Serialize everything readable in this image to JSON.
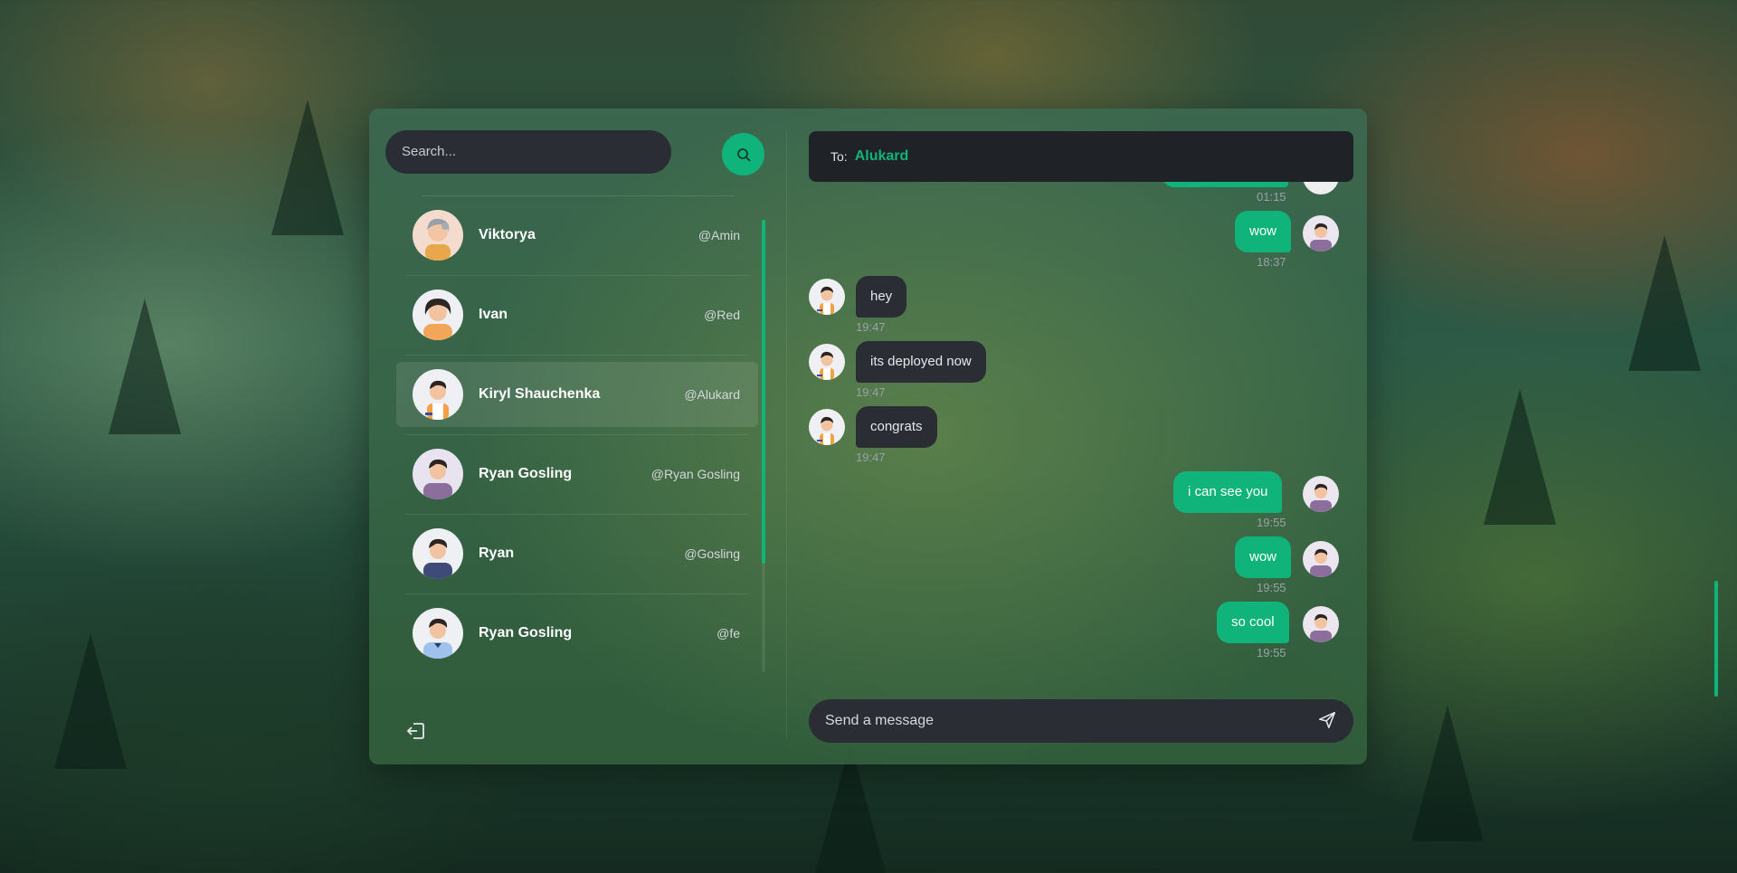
{
  "colors": {
    "accent": "#10b47a",
    "input_bg": "#2a2d33",
    "header_bg": "#1f2226"
  },
  "sidebar": {
    "search_placeholder": "Search...",
    "search_icon": "search-icon",
    "logout_icon": "logout-icon",
    "contacts": [
      {
        "name": "Viktorya",
        "handle": "@Amin",
        "avatar": "avatar-grey-hair-woman",
        "active": false
      },
      {
        "name": "Ivan",
        "handle": "@Red",
        "avatar": "avatar-dark-hair-woman",
        "active": false
      },
      {
        "name": "Kiryl Shauchenka",
        "handle": "@Alukard",
        "avatar": "avatar-man-orange",
        "active": true
      },
      {
        "name": "Ryan Gosling",
        "handle": "@Ryan Gosling",
        "avatar": "avatar-man-purple",
        "active": false
      },
      {
        "name": "Ryan",
        "handle": "@Gosling",
        "avatar": "avatar-man-navy",
        "active": false
      },
      {
        "name": "Ryan Gosling",
        "handle": "@fe",
        "avatar": "avatar-man-blue",
        "active": false
      }
    ]
  },
  "chat": {
    "to_label": "To:",
    "to_name": "Alukard",
    "messages": [
      {
        "text": "",
        "time": "01:15",
        "dir": "out"
      },
      {
        "text": "wow",
        "time": "18:37",
        "dir": "out"
      },
      {
        "text": "hey",
        "time": "19:47",
        "dir": "in"
      },
      {
        "text": "its deployed now",
        "time": "19:47",
        "dir": "in"
      },
      {
        "text": "congrats",
        "time": "19:47",
        "dir": "in"
      },
      {
        "text": "i can see you",
        "time": "19:55",
        "dir": "out"
      },
      {
        "text": "wow",
        "time": "19:55",
        "dir": "out"
      },
      {
        "text": "so cool",
        "time": "19:55",
        "dir": "out"
      }
    ],
    "compose_placeholder": "Send a message",
    "send_icon": "send-icon"
  }
}
